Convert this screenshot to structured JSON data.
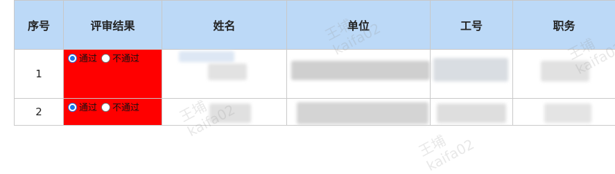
{
  "table": {
    "headers": [
      "序号",
      "评审结果",
      "姓名",
      "单位",
      "工号",
      "职务"
    ],
    "rows": [
      {
        "index": "1",
        "options": [
          {
            "label": "通过",
            "checked": true
          },
          {
            "label": "不通过",
            "checked": false
          }
        ]
      },
      {
        "index": "2",
        "options": [
          {
            "label": "通过",
            "checked": true
          },
          {
            "label": "不通过",
            "checked": false
          }
        ]
      }
    ]
  },
  "watermark": {
    "name": "王埔",
    "account": "kaifa02"
  },
  "colors": {
    "header_bg": "#bcd9f7",
    "review_bg": "#ff0000",
    "radio_accent": "#1a73e8"
  }
}
